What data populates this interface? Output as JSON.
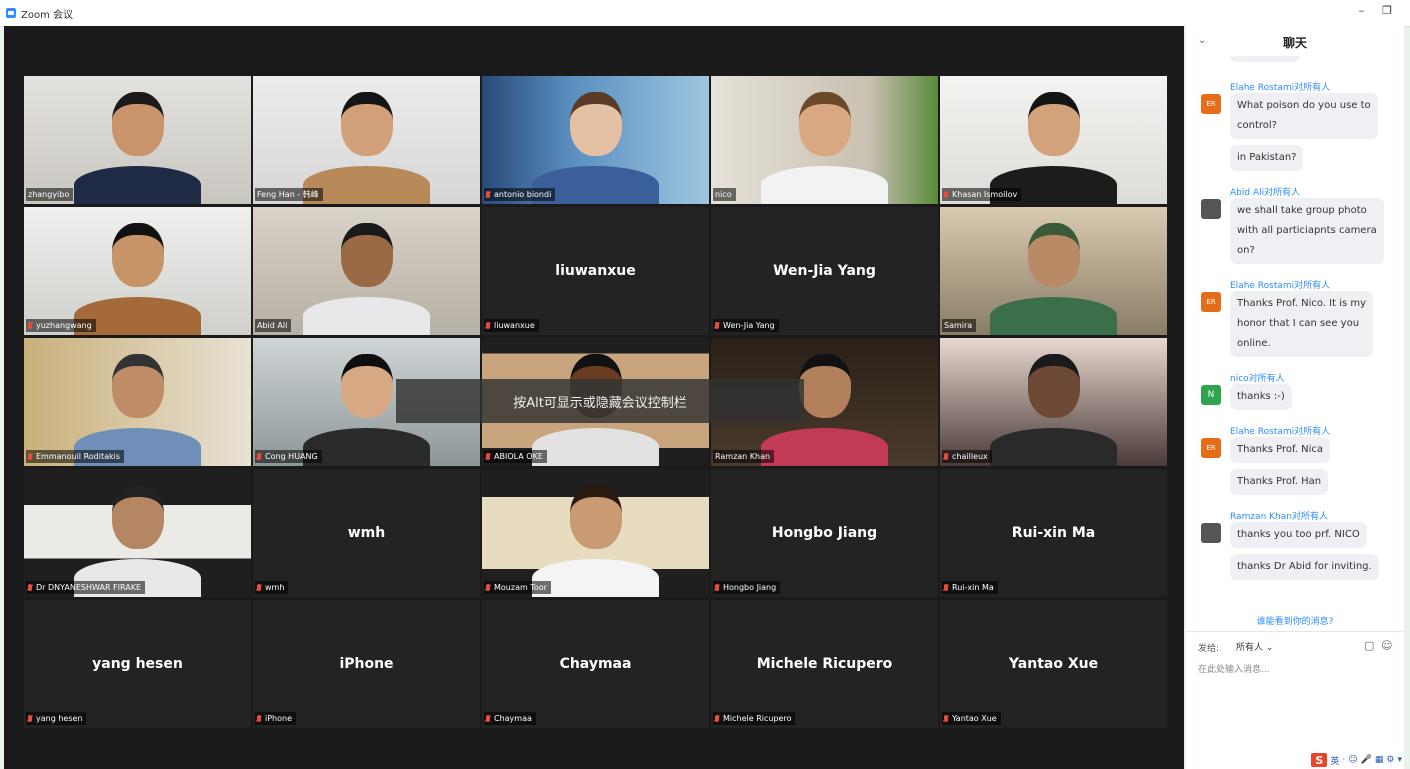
{
  "window": {
    "title": "Zoom 会议",
    "minimize": "–",
    "restore": "❐"
  },
  "overlay": {
    "hint": "按Alt可显示或隐藏会议控制栏"
  },
  "participants": [
    {
      "name": "zhangyibo",
      "video": true,
      "muted": false
    },
    {
      "name": "Feng Han - 韩峰",
      "video": true,
      "muted": false
    },
    {
      "name": "antonio biondi",
      "video": true,
      "muted": true
    },
    {
      "name": "nico",
      "video": true,
      "muted": false,
      "active": true
    },
    {
      "name": "Khasan Ismoilov",
      "video": true,
      "muted": true
    },
    {
      "name": "yuzhangwang",
      "video": true,
      "muted": true
    },
    {
      "name": "Abid Ali",
      "video": true,
      "muted": false
    },
    {
      "name": "liuwanxue",
      "video": false,
      "muted": true
    },
    {
      "name": "Wen-Jia Yang",
      "video": false,
      "muted": true
    },
    {
      "name": "Samira",
      "video": true,
      "muted": false
    },
    {
      "name": "Emmanouil Roditakis",
      "video": true,
      "muted": true
    },
    {
      "name": "Cong HUANG",
      "video": true,
      "muted": true
    },
    {
      "name": "ABIOLA OKE",
      "video": true,
      "muted": true
    },
    {
      "name": "Ramzan Khan",
      "video": true,
      "muted": false
    },
    {
      "name": "chailleux",
      "video": true,
      "muted": true
    },
    {
      "name": "Dr DNYANESHWAR FIRAKE",
      "video": true,
      "muted": true
    },
    {
      "name": "wmh",
      "video": false,
      "muted": true
    },
    {
      "name": "Mouzam Toor",
      "video": true,
      "muted": true
    },
    {
      "name": "Hongbo Jiang",
      "video": false,
      "muted": true
    },
    {
      "name": "Rui-xin Ma",
      "video": false,
      "muted": true
    },
    {
      "name": "yang hesen",
      "video": false,
      "muted": true
    },
    {
      "name": "iPhone",
      "video": false,
      "muted": true
    },
    {
      "name": "Chaymaa",
      "video": false,
      "muted": true
    },
    {
      "name": "Michele Ricupero",
      "video": false,
      "muted": true
    },
    {
      "name": "Yantao Xue",
      "video": false,
      "muted": true
    }
  ],
  "chat": {
    "title": "聊天",
    "collapse": "⌄",
    "messages": [
      {
        "sender": "Elahe Rostami对所有人",
        "avatar": "ER",
        "avatar_type": "er",
        "bubbles": [
          "What poison do you use to\ncontrol?",
          "in Pakistan?"
        ]
      },
      {
        "sender": "Abid Ali对所有人",
        "avatar": "",
        "avatar_type": "photo",
        "bubbles": [
          "we shall take group photo\nwith all particiapnts camera\non?"
        ]
      },
      {
        "sender": "Elahe Rostami对所有人",
        "avatar": "ER",
        "avatar_type": "er",
        "bubbles": [
          "Thanks Prof. Nico. It is my\nhonor that I can see you\nonline."
        ]
      },
      {
        "sender": "nico对所有人",
        "avatar": "N",
        "avatar_type": "n",
        "bubbles": [
          "thanks :-)"
        ]
      },
      {
        "sender": "Elahe Rostami对所有人",
        "avatar": "ER",
        "avatar_type": "er",
        "bubbles": [
          "Thanks Prof. Nica",
          "Thanks Prof. Han"
        ]
      },
      {
        "sender": "Ramzan Khan对所有人",
        "avatar": "",
        "avatar_type": "photo",
        "bubbles": [
          "thanks you too prf. NICO",
          "thanks Dr Abid for inviting."
        ]
      }
    ],
    "footer_link": "谁能看到你的消息?",
    "send_to_label": "发给:",
    "recipient": "所有人 ⌄",
    "input_placeholder": "在此处输入消息...",
    "ime": {
      "logo": "S",
      "items": [
        "英",
        "·",
        "☺",
        "🎤",
        "▦",
        "⚙",
        "▾"
      ]
    }
  }
}
